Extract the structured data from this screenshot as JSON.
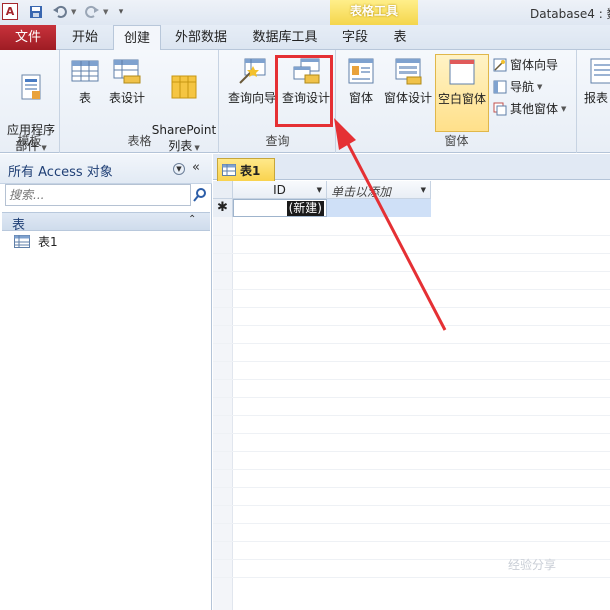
{
  "quick_access": {
    "app_logo": "A",
    "save_icon": "save-icon",
    "undo_icon": "undo-icon",
    "redo_icon": "redo-icon"
  },
  "context_header": "表格工具",
  "window_title": "Database4 : 数",
  "tabs": {
    "file": "文件",
    "home": "开始",
    "create": "创建",
    "external": "外部数据",
    "dbtools": "数据库工具",
    "fields": "字段",
    "table": "表"
  },
  "ribbon": {
    "templates": {
      "label": "模板",
      "app_parts": "应用程序\n部件"
    },
    "tables": {
      "label": "表格",
      "table": "表",
      "table_design": "表设计",
      "sharepoint": "SharePoint\n列表"
    },
    "queries": {
      "label": "查询",
      "query_wizard": "查询向导",
      "query_design": "查询设计"
    },
    "forms": {
      "label": "窗体",
      "form": "窗体",
      "form_design": "窗体设计",
      "blank_form": "空白窗体",
      "form_wizard": "窗体向导",
      "navigation": "导航",
      "more_forms": "其他窗体"
    },
    "reports": {
      "report": "报表"
    }
  },
  "nav": {
    "title": "所有 Access 对象",
    "search_placeholder": "搜索...",
    "group": "表",
    "items": [
      {
        "label": "表1"
      }
    ]
  },
  "document": {
    "tab": "表1",
    "columns": [
      {
        "label": "ID"
      },
      {
        "label": "单击以添加"
      }
    ],
    "new_row_marker": "✱",
    "new_record": "(新建)"
  },
  "watermark": "经验分享",
  "colors": {
    "accent_red": "#e53034",
    "file_tab": "#b0262e",
    "context_yellow": "#f4d64c"
  }
}
